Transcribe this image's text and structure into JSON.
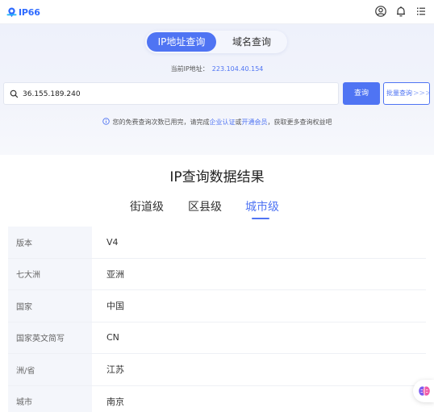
{
  "header": {
    "logo_text": "IP66",
    "icons": [
      "user-circle-icon",
      "bell-icon",
      "menu-list-icon"
    ]
  },
  "search_tabs": {
    "ip_label": "IP地址查询",
    "domain_label": "域名查询"
  },
  "current_ip": {
    "label": "当前IP地址：",
    "value": "223.104.40.154"
  },
  "search": {
    "value": "36.155.189.240",
    "query_label": "查询",
    "batch_label": "批量查询",
    "batch_chevrons": ">>>"
  },
  "notice": {
    "part1": "您的免费查询次数已用完，请完成",
    "link1": "企业认证",
    "part2": "或",
    "link2": "开通会员",
    "part3": "，获取更多查询权益吧"
  },
  "result": {
    "title": "IP查询数据结果",
    "tabs": [
      "街道级",
      "区县级",
      "城市级"
    ],
    "active_tab": "城市级",
    "rows": [
      {
        "label": "版本",
        "value": "V4"
      },
      {
        "label": "七大洲",
        "value": "亚洲"
      },
      {
        "label": "国家",
        "value": "中国"
      },
      {
        "label": "国家英文简写",
        "value": "CN"
      },
      {
        "label": "洲/省",
        "value": "江苏"
      },
      {
        "label": "城市",
        "value": "南京"
      }
    ]
  },
  "colors": {
    "accent": "#4f74f3",
    "label_bg": "#f4f6fb"
  }
}
